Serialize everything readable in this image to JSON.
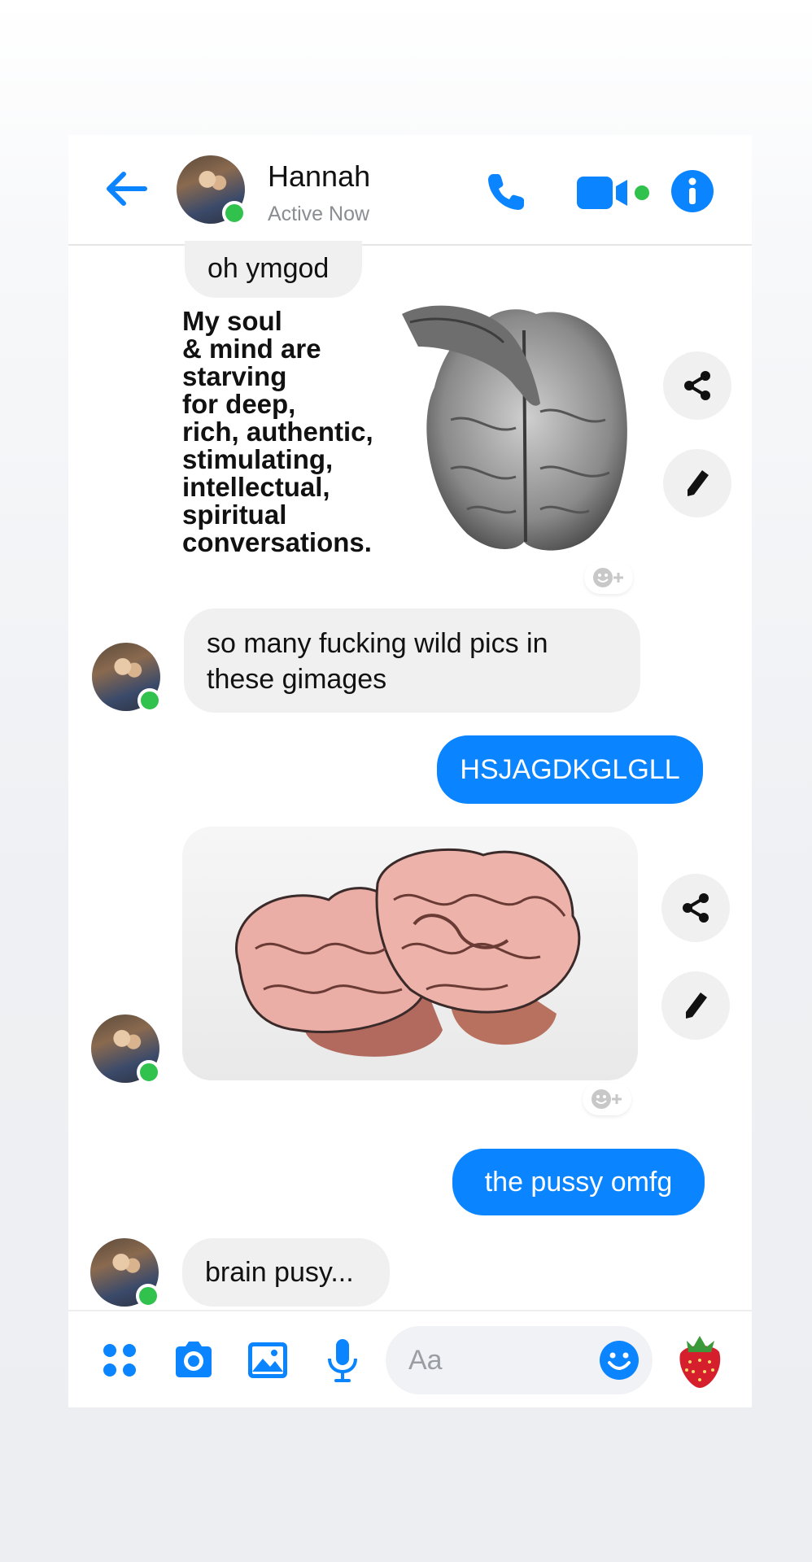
{
  "header": {
    "title": "Hannah",
    "status": "Active Now"
  },
  "messages": {
    "m1": "oh ymgod",
    "meme_text": "My soul\n& mind are\nstarving\nfor deep,\nrich, authentic,\nstimulating,\nintellectual,\nspiritual\nconversations.",
    "m2": "so many fucking wild pics in these gimages",
    "m3": "HSJAGDKGLGLL",
    "m4": "the pussy omfg",
    "m5": "brain pusy..."
  },
  "composer": {
    "placeholder": "Aa"
  },
  "icons": {
    "back": "back-arrow-icon",
    "phone": "phone-icon",
    "video": "video-camera-icon",
    "info": "info-icon",
    "share": "share-icon",
    "edit": "pencil-icon",
    "react": "add-reaction-icon",
    "apps": "apps-grid-icon",
    "camera": "camera-icon",
    "gallery": "gallery-icon",
    "mic": "microphone-icon",
    "emoji": "emoji-icon",
    "like": "strawberry-icon"
  },
  "colors": {
    "accent": "#0a84ff",
    "online": "#31c24d",
    "incoming_bubble": "#f0f0f0"
  }
}
